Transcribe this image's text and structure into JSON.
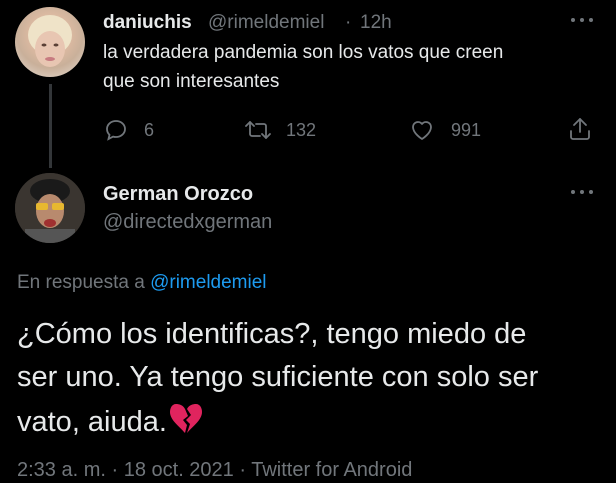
{
  "parent_tweet": {
    "display_name": "daniuchis",
    "handle": "@rimeldemiel",
    "separator": "·",
    "time": "12h",
    "text_line1": "la verdadera pandemia son los vatos que creen",
    "text_line2": "que son interesantes",
    "replies": "6",
    "retweets": "132",
    "likes": "991"
  },
  "main_tweet": {
    "display_name": "German Orozco",
    "handle": "@directedxgerman",
    "reply_prefix": "En respuesta a",
    "reply_to": "@rimeldemiel",
    "text_line1": "¿Cómo los identificas?, tengo miedo de",
    "text_line2": "ser uno. Ya tengo suficiente con solo ser",
    "text_line3": "vato, aiuda.",
    "emoji": "💔",
    "timestamp": "2:33 a. m. · 18 oct. 2021 · Twitter for Android"
  },
  "icons": {
    "reply": "reply-icon",
    "retweet": "retweet-icon",
    "like": "heart-icon",
    "share": "share-icon",
    "more": "more-icon"
  },
  "colors": {
    "background": "#000000",
    "text": "#e7e9ea",
    "secondary": "#71767b",
    "link": "#1d9bf0",
    "emoji": "#e0245e"
  }
}
